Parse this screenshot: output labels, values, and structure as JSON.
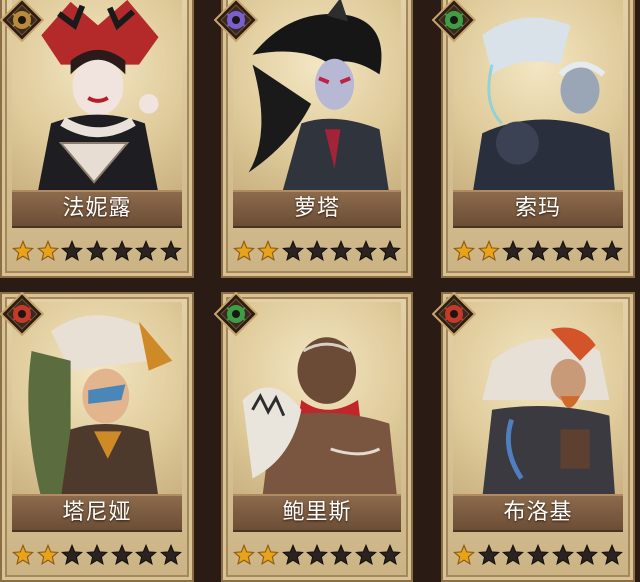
{
  "colors": {
    "star_filled": "#e8a21c",
    "star_empty": "#2b2320",
    "badge_brown": "#b98a3a",
    "badge_purple": "#7a5fd0",
    "badge_green": "#3f9e45",
    "badge_red": "#c43a2a"
  },
  "cards": [
    {
      "name": "法妮露",
      "stars_filled": 2,
      "stars_total": 7,
      "faction_icon": "golden-beast-faction-icon",
      "faction_color": "#b98a3a"
    },
    {
      "name": "萝塔",
      "stars_filled": 2,
      "stars_total": 7,
      "faction_icon": "purple-spider-faction-icon",
      "faction_color": "#7a5fd0"
    },
    {
      "name": "索玛",
      "stars_filled": 2,
      "stars_total": 7,
      "faction_icon": "green-eye-faction-icon",
      "faction_color": "#3f9e45"
    },
    {
      "name": "塔尼娅",
      "stars_filled": 2,
      "stars_total": 7,
      "faction_icon": "red-demon-faction-icon",
      "faction_color": "#c43a2a"
    },
    {
      "name": "鲍里斯",
      "stars_filled": 2,
      "stars_total": 7,
      "faction_icon": "green-eye-faction-icon",
      "faction_color": "#3f9e45"
    },
    {
      "name": "布洛基",
      "stars_filled": 1,
      "stars_total": 7,
      "faction_icon": "red-demon-faction-icon",
      "faction_color": "#c43a2a"
    }
  ]
}
